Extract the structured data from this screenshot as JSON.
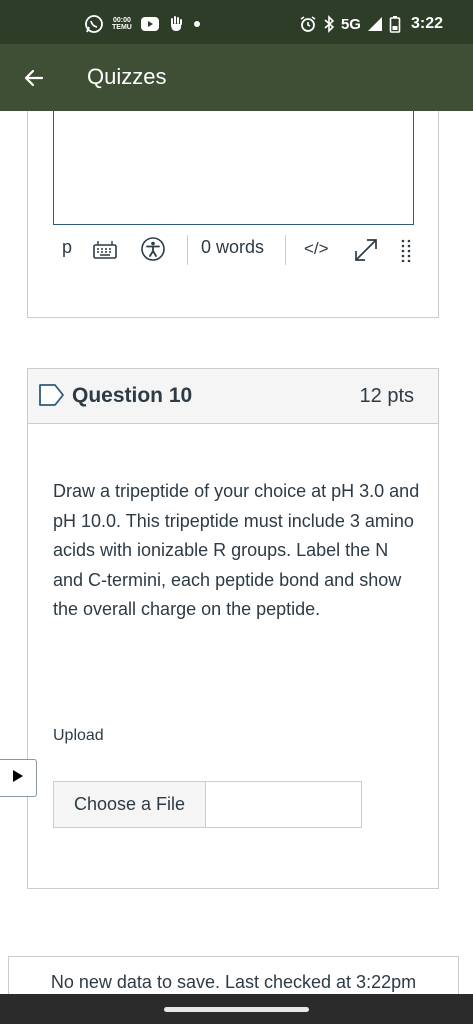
{
  "status_bar": {
    "time": "3:22",
    "network": "5G",
    "notification_text": "TEMU",
    "notification_small": "00:00"
  },
  "app_bar": {
    "title": "Quizzes"
  },
  "previous_question_editor": {
    "toolbar": {
      "paragraph_label": "p",
      "word_count": "0 words",
      "html_label": "</>"
    }
  },
  "question": {
    "title": "Question 10",
    "points": "12 pts",
    "text": "Draw a tripeptide of your choice at pH 3.0 and pH 10.0. This tripeptide must include 3 amino acids with ionizable R groups. Label the N and C-termini, each peptide bond and show the overall charge on the peptide.",
    "upload_label": "Upload",
    "choose_file_label": "Choose a File"
  },
  "save_status": {
    "text": "No new data to save. Last checked at 3:22pm"
  },
  "colors": {
    "status_bar_bg": "#2e3d27",
    "app_bar_bg": "#3e4f36",
    "text": "#2d3b45",
    "editor_border": "#2d5b7a",
    "flag_icon": "#2d5b7a"
  }
}
